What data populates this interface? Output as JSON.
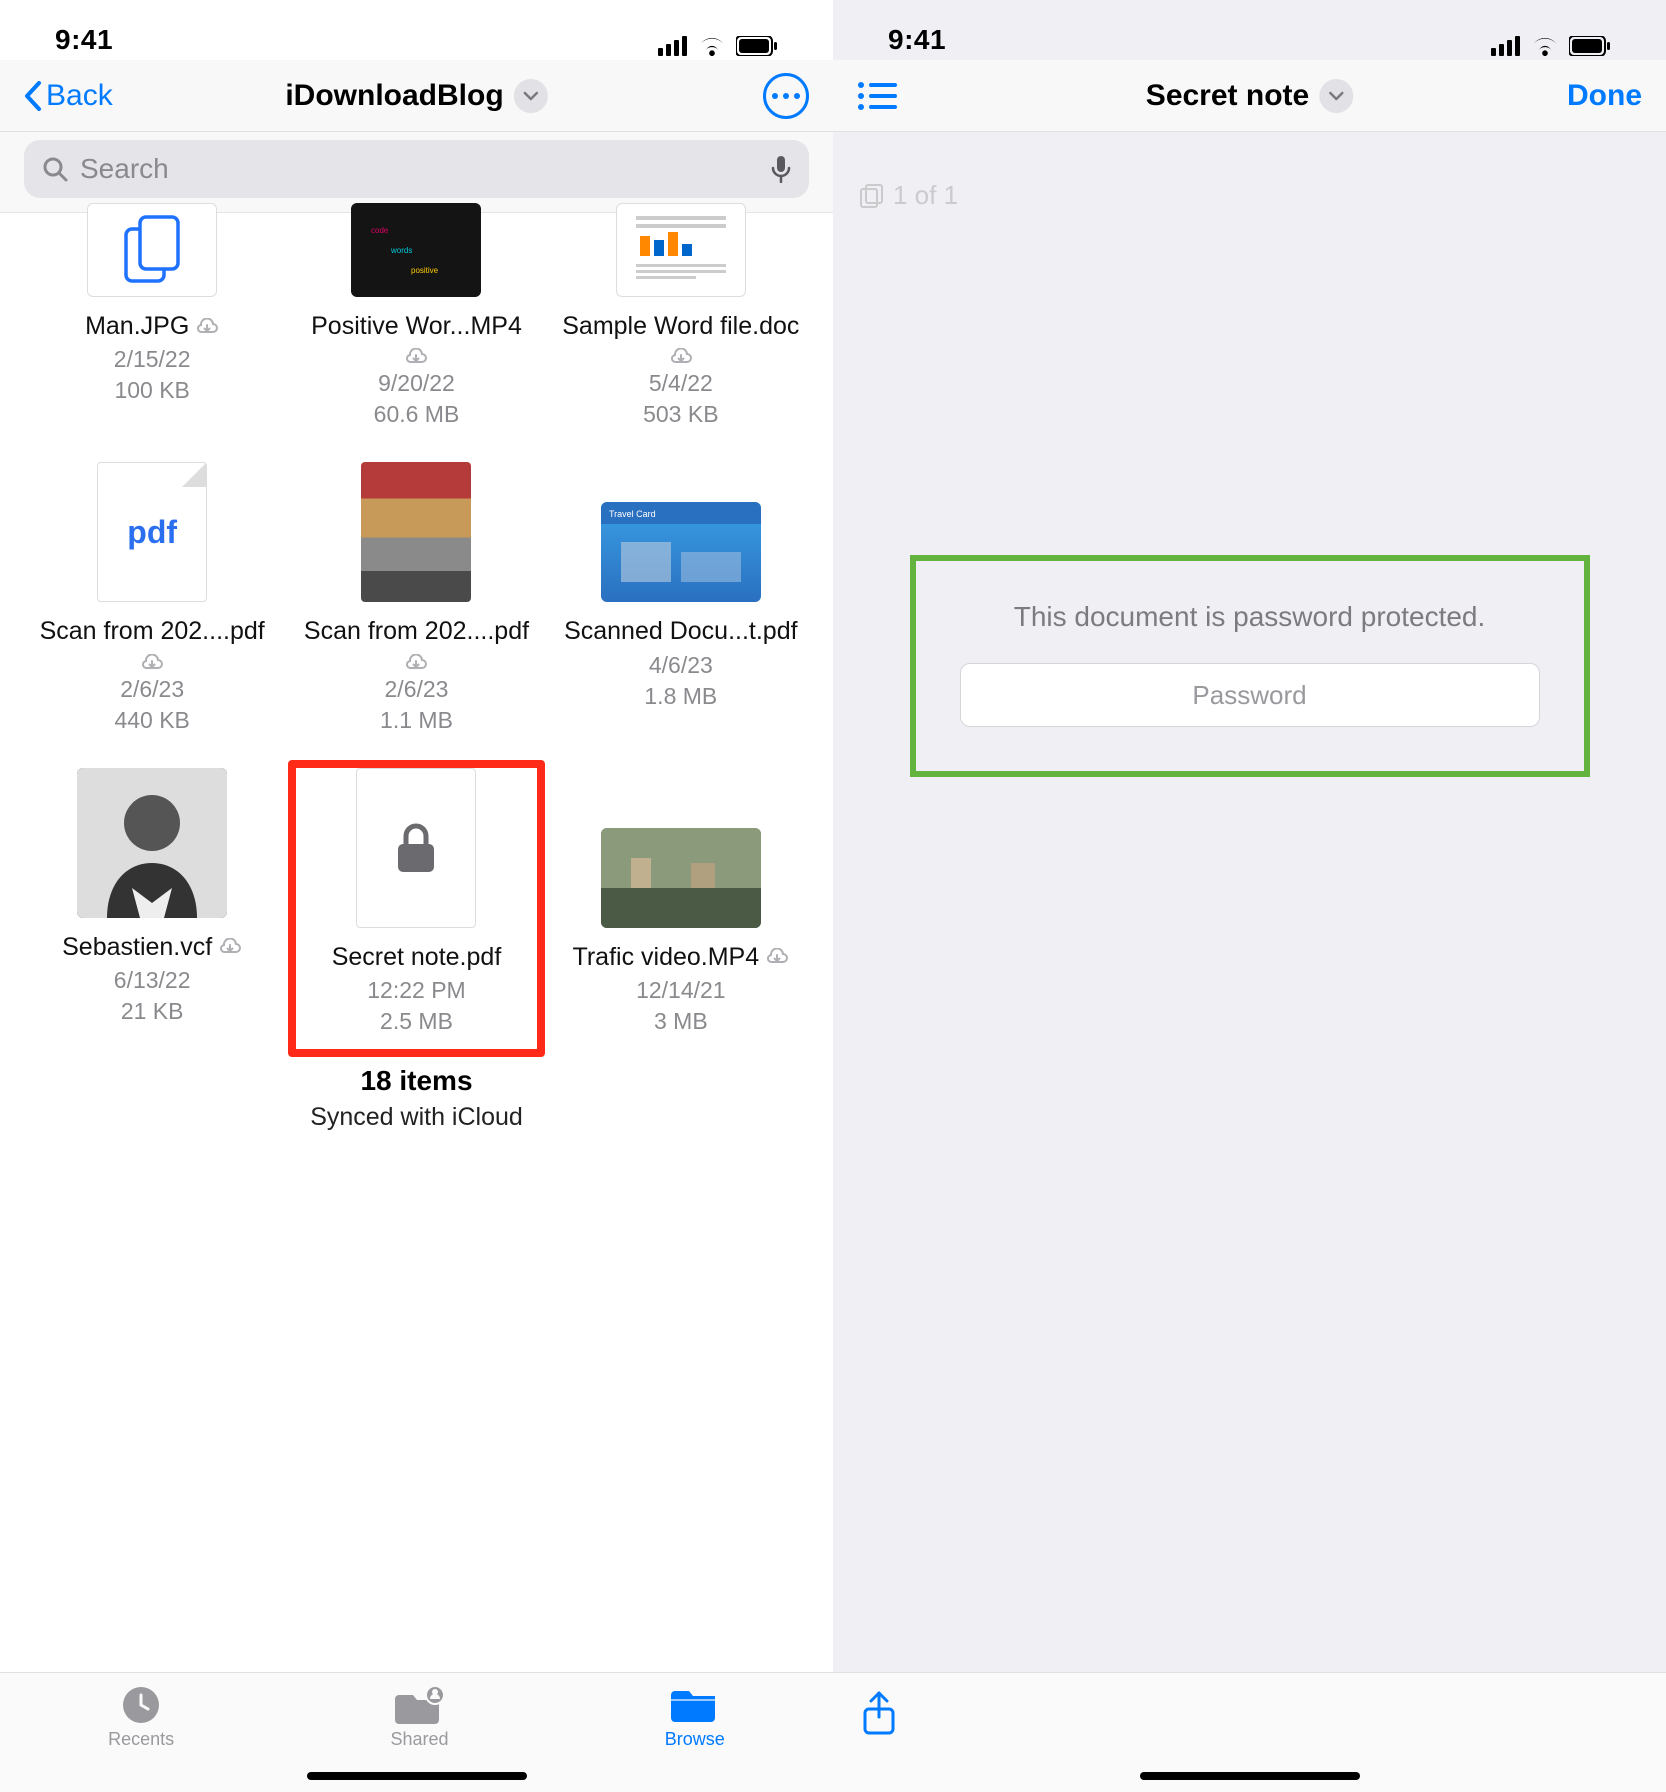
{
  "left": {
    "status_time": "9:41",
    "back_label": "Back",
    "title": "iDownloadBlog",
    "search_placeholder": "Search",
    "files": [
      {
        "name": "Man.JPG",
        "date": "2/15/22",
        "size": "100 KB",
        "cloud": true
      },
      {
        "name": "Positive Wor...MP4",
        "date": "9/20/22",
        "size": "60.6 MB",
        "cloud": true
      },
      {
        "name": "Sample Word file.doc",
        "date": "5/4/22",
        "size": "503 KB",
        "cloud": true
      },
      {
        "name": "Scan from 202....pdf",
        "date": "2/6/23",
        "size": "440 KB",
        "cloud": true
      },
      {
        "name": "Scan from 202....pdf",
        "date": "2/6/23",
        "size": "1.1 MB",
        "cloud": true
      },
      {
        "name": "Scanned Docu...t.pdf",
        "date": "4/6/23",
        "size": "1.8 MB",
        "cloud": false
      },
      {
        "name": "Sebastien.vcf",
        "date": "6/13/22",
        "size": "21 KB",
        "cloud": true
      },
      {
        "name": "Secret note.pdf",
        "date": "12:22 PM",
        "size": "2.5 MB",
        "cloud": false,
        "highlight": true
      },
      {
        "name": "Trafic video.MP4",
        "date": "12/14/21",
        "size": "3 MB",
        "cloud": true
      }
    ],
    "summary_count": "18 items",
    "summary_sync": "Synced with iCloud",
    "tabs": {
      "recents": "Recents",
      "shared": "Shared",
      "browse": "Browse"
    }
  },
  "right": {
    "status_time": "9:41",
    "title": "Secret note",
    "done_label": "Done",
    "pagecount": "1 of 1",
    "lock_message": "This document is password protected.",
    "password_placeholder": "Password"
  },
  "colors": {
    "accent": "#007aff",
    "highlight_red": "#ff2a18",
    "highlight_green": "#62b43f"
  }
}
